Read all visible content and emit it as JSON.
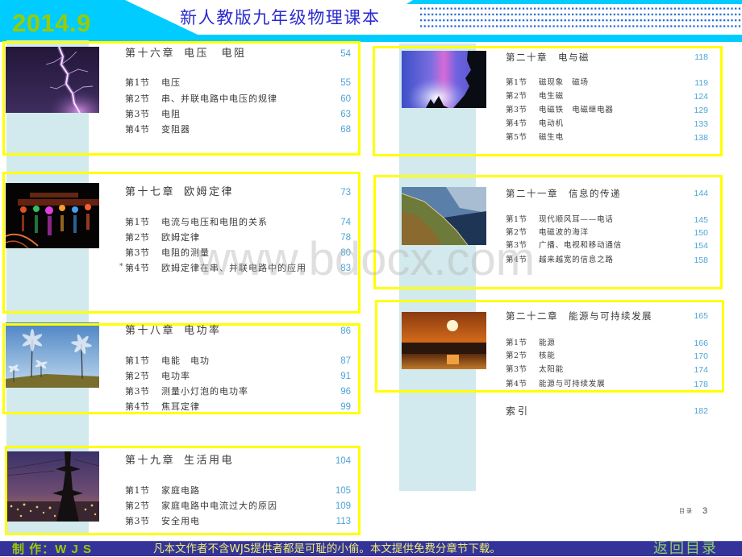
{
  "header": {
    "date": "2014.9",
    "title": "新人教版九年级物理课本"
  },
  "colors": {
    "header_cyan": "#00ccff",
    "date_green": "#99cc00",
    "title_blue": "#2b2bd0",
    "frame_yellow": "#ffff00",
    "strip_teal": "#d2eaed",
    "page_number_blue": "#4ea4d9",
    "footer_bg": "#333399",
    "footer_notice": "#f0ee70",
    "footer_back_link": "#8fcf6a"
  },
  "left_column": {
    "chapters": [
      {
        "number": "第十六章",
        "title": "电压　电阻",
        "page": "54",
        "sections": [
          {
            "label": "第1节",
            "title": "电压",
            "page": "55"
          },
          {
            "label": "第2节",
            "title": "串、并联电路中电压的规律",
            "page": "60"
          },
          {
            "label": "第3节",
            "title": "电阻",
            "page": "63"
          },
          {
            "label": "第4节",
            "title": "变阻器",
            "page": "68"
          }
        ]
      },
      {
        "number": "第十七章",
        "title": "欧姆定律",
        "page": "73",
        "sections": [
          {
            "label": "第1节",
            "title": "电流与电压和电阻的关系",
            "page": "74"
          },
          {
            "label": "第2节",
            "title": "欧姆定律",
            "page": "78"
          },
          {
            "label": "第3节",
            "title": "电阻的测量",
            "page": "80"
          },
          {
            "marker": "*",
            "label": "第4节",
            "title": "欧姆定律在串、并联电路中的应用",
            "page": "83"
          }
        ]
      },
      {
        "number": "第十八章",
        "title": "电功率",
        "page": "86",
        "sections": [
          {
            "label": "第1节",
            "title": "电能　电功",
            "page": "87"
          },
          {
            "label": "第2节",
            "title": "电功率",
            "page": "91"
          },
          {
            "label": "第3节",
            "title": "测量小灯泡的电功率",
            "page": "96"
          },
          {
            "label": "第4节",
            "title": "焦耳定律",
            "page": "99"
          }
        ]
      },
      {
        "number": "第十九章",
        "title": "生活用电",
        "page": "104",
        "sections": [
          {
            "label": "第1节",
            "title": "家庭电路",
            "page": "105"
          },
          {
            "label": "第2节",
            "title": "家庭电路中电流过大的原因",
            "page": "109"
          },
          {
            "label": "第3节",
            "title": "安全用电",
            "page": "113"
          }
        ]
      }
    ]
  },
  "right_column": {
    "chapters": [
      {
        "number": "第二十章",
        "title": "电与磁",
        "page": "118",
        "sections": [
          {
            "label": "第1节",
            "title": "磁现象　磁场",
            "page": "119"
          },
          {
            "label": "第2节",
            "title": "电生磁",
            "page": "124"
          },
          {
            "label": "第3节",
            "title": "电磁铁　电磁继电器",
            "page": "129"
          },
          {
            "label": "第4节",
            "title": "电动机",
            "page": "133"
          },
          {
            "label": "第5节",
            "title": "磁生电",
            "page": "138"
          }
        ]
      },
      {
        "number": "第二十一章",
        "title": "信息的传递",
        "page": "144",
        "sections": [
          {
            "label": "第1节",
            "title": "现代顺风耳——电话",
            "page": "145"
          },
          {
            "label": "第2节",
            "title": "电磁波的海洋",
            "page": "150"
          },
          {
            "label": "第3节",
            "title": "广播、电视和移动通信",
            "page": "154"
          },
          {
            "label": "第4节",
            "title": "越来越宽的信息之路",
            "page": "158"
          }
        ]
      },
      {
        "number": "第二十二章",
        "title": "能源与可持续发展",
        "page": "165",
        "sections": [
          {
            "label": "第1节",
            "title": "能源",
            "page": "166"
          },
          {
            "label": "第2节",
            "title": "核能",
            "page": "170"
          },
          {
            "label": "第3节",
            "title": "太阳能",
            "page": "174"
          },
          {
            "label": "第4节",
            "title": "能源与可持续发展",
            "page": "178"
          }
        ]
      }
    ],
    "index": {
      "label": "索引",
      "page": "182"
    }
  },
  "toc_page_footer": {
    "label": "目录",
    "page": "3"
  },
  "watermark": "www.bdocx.com",
  "footer": {
    "author": "制 作：W J S",
    "notice": "凡本文作者不含WJS提供者都是可耻的小偷。本文提供免费分章节下载。",
    "back_link": "返回目录"
  }
}
